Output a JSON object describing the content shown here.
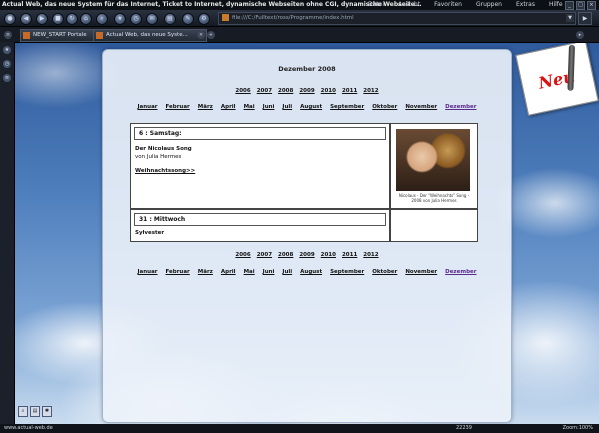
{
  "window": {
    "title": "Actual Web, das neue System für das Internet, Ticket to Internet, dynamische Webseiten ohne CGI, dynamische Webseite...",
    "menu": [
      "Datei",
      "Ansicht",
      "Favoriten",
      "Gruppen",
      "Extras",
      "Hilfe"
    ]
  },
  "address": {
    "url": "file:///C:/Fulltext/ross/Programme/index.html"
  },
  "tabs": [
    {
      "label": "NEW_START Portale"
    },
    {
      "label": "Actual Web, das neue Syste..."
    }
  ],
  "page": {
    "month_title": "Dezember 2008",
    "years": [
      "2006",
      "2007",
      "2008",
      "2009",
      "2010",
      "2011",
      "2012"
    ],
    "months": [
      "Januar",
      "Februar",
      "März",
      "April",
      "Mai",
      "Juni",
      "Juli",
      "August",
      "September",
      "Oktober",
      "November",
      "Dezember"
    ],
    "active_month": "Dezember",
    "entries": [
      {
        "day": "6 : Samstag:",
        "title": "Der Nicolaus Song",
        "author": "von Julia Hermes",
        "link": "Weihnachtssong>>",
        "photo_caption": "Nicolaus - Der \"Weihnachts\" Song - 2008 von Julia Hermes"
      },
      {
        "day": "31 : Mittwoch",
        "title": "Sylvester"
      }
    ],
    "badge_text": "Neu"
  },
  "status": {
    "url": "www.actual-web.de",
    "count": "22239",
    "zoom": "Zoom:100%"
  },
  "colors": {
    "active_month": "#5a2a8c",
    "badge": "#dd1111"
  }
}
